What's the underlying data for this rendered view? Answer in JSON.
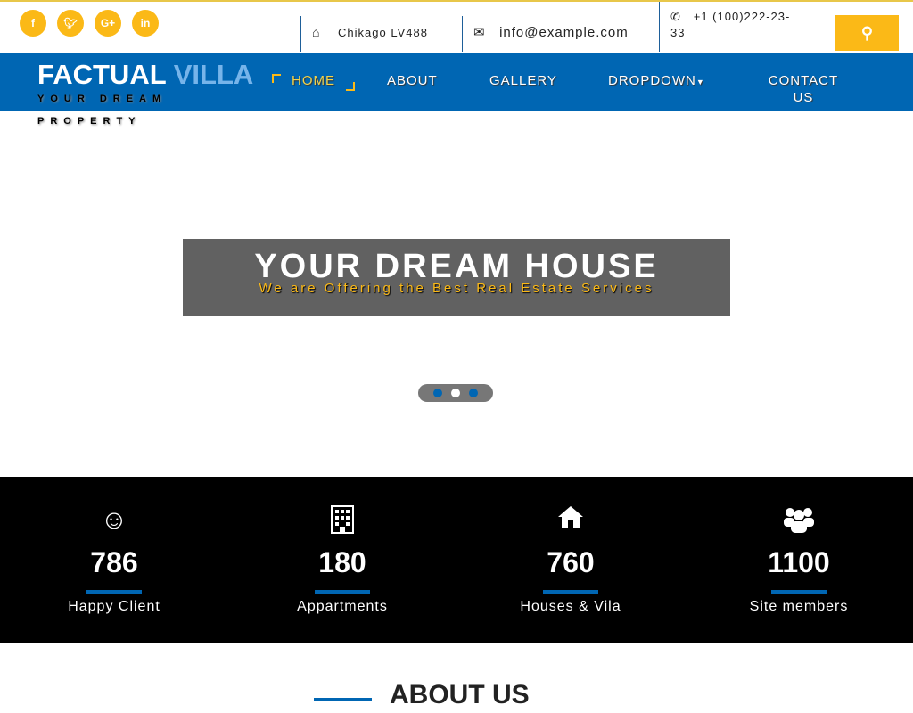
{
  "social": [
    {
      "icon": "facebook-icon",
      "label": "f"
    },
    {
      "icon": "twitter-icon",
      "label": "t"
    },
    {
      "icon": "google-plus-icon",
      "label": "G+"
    },
    {
      "icon": "linkedin-icon",
      "label": "in"
    }
  ],
  "contact": {
    "address": "Chikago LV488",
    "email": "info@example.com",
    "phone": "+1 (100)222-23-33"
  },
  "logo": {
    "part1": "FACTUAL",
    "part2": "VILLA",
    "tag1": "YOUR DREAM",
    "tag2": "PROPERTY"
  },
  "nav": {
    "home": "HOME",
    "about": "ABOUT",
    "gallery": "GALLERY",
    "dropdown": "DROPDOWN",
    "contact": "CONTACT US"
  },
  "hero": {
    "title": "YOUR DREAM HOUSE",
    "subtitle": "We are Offering the Best Real Estate Services",
    "active_slide": 2,
    "slides": 3
  },
  "stats": [
    {
      "icon": "smiley-icon",
      "value": "786",
      "label": "Happy Client"
    },
    {
      "icon": "building-icon",
      "value": "180",
      "label": "Appartments"
    },
    {
      "icon": "home-icon",
      "value": "760",
      "label": "Houses & Vila"
    },
    {
      "icon": "users-icon",
      "value": "1100",
      "label": "Site members"
    }
  ],
  "about": {
    "title": "ABOUT US"
  },
  "colors": {
    "accent": "#fbb917",
    "brand": "#0066b3"
  }
}
